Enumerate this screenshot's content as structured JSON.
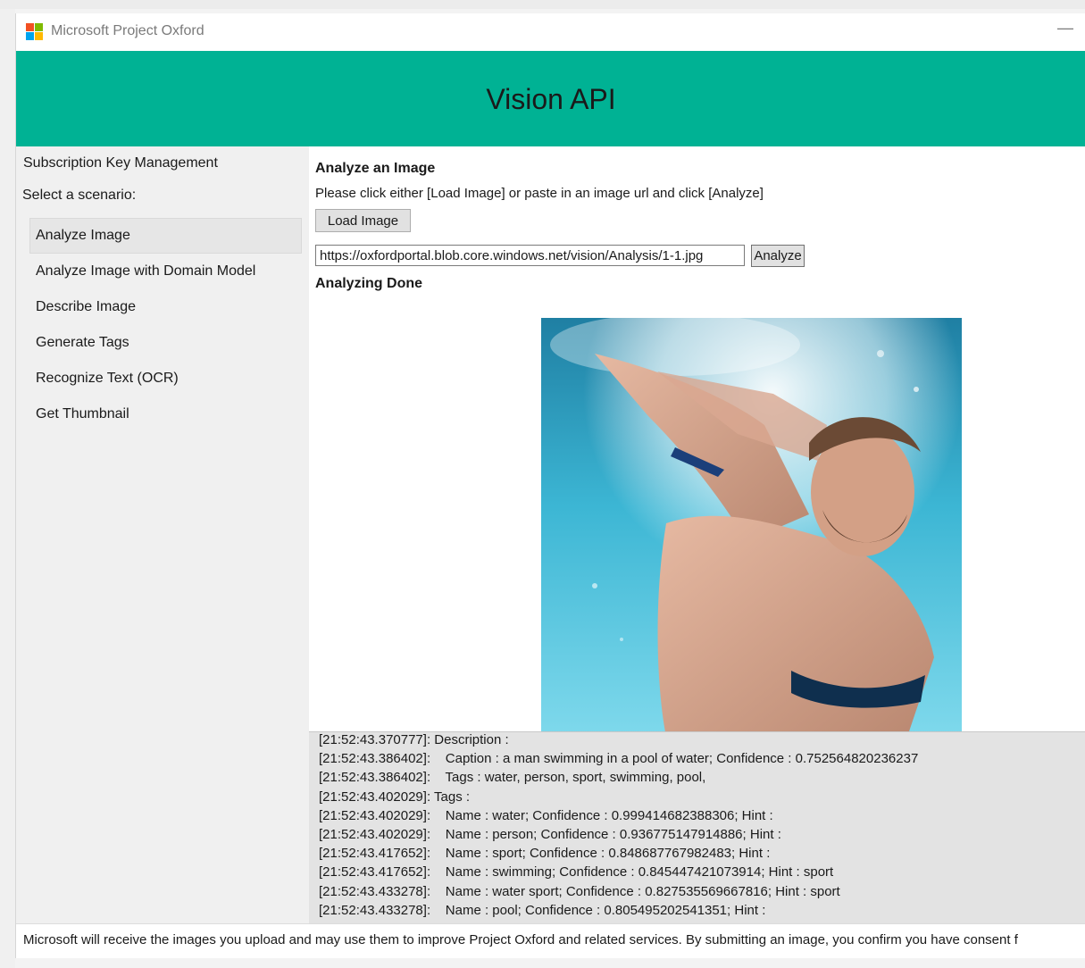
{
  "window": {
    "title": "Microsoft Project Oxford",
    "minimize_glyph": "—",
    "logo_colors": [
      "#f25022",
      "#7fba00",
      "#00a4ef",
      "#ffb900"
    ]
  },
  "banner": {
    "title": "Vision API",
    "color": "#00b294"
  },
  "sidebar": {
    "subscription_key_label": "Subscription Key Management",
    "select_label": "Select a scenario:",
    "items": [
      {
        "label": "Analyze Image",
        "selected": true
      },
      {
        "label": "Analyze Image with Domain Model"
      },
      {
        "label": "Describe Image"
      },
      {
        "label": "Generate Tags"
      },
      {
        "label": "Recognize Text (OCR)"
      },
      {
        "label": "Get Thumbnail"
      }
    ]
  },
  "main": {
    "title": "Analyze an Image",
    "instructions": "Please click either [Load Image] or paste in an image url and click [Analyze]",
    "load_button": "Load Image",
    "url_value": "https://oxfordportal.blob.core.windows.net/vision/Analysis/1-1.jpg",
    "analyze_button": "Analyze",
    "status": "Analyzing Done"
  },
  "log": {
    "lines": [
      "[21:52:43.370777]: Description :",
      "[21:52:43.386402]:    Caption : a man swimming in a pool of water; Confidence : 0.752564820236237",
      "[21:52:43.386402]:    Tags : water, person, sport, swimming, pool,",
      "[21:52:43.402029]: Tags :",
      "[21:52:43.402029]:    Name : water; Confidence : 0.999414682388306; Hint :",
      "[21:52:43.402029]:    Name : person; Confidence : 0.936775147914886; Hint :",
      "[21:52:43.417652]:    Name : sport; Confidence : 0.848687767982483; Hint :",
      "[21:52:43.417652]:    Name : swimming; Confidence : 0.845447421073914; Hint : sport",
      "[21:52:43.433278]:    Name : water sport; Confidence : 0.827535569667816; Hint : sport",
      "[21:52:43.433278]:    Name : pool; Confidence : 0.805495202541351; Hint :"
    ]
  },
  "footer": {
    "text": "Microsoft will receive the images you upload and may use them to improve Project Oxford and related services. By submitting an image, you confirm you have consent f"
  }
}
